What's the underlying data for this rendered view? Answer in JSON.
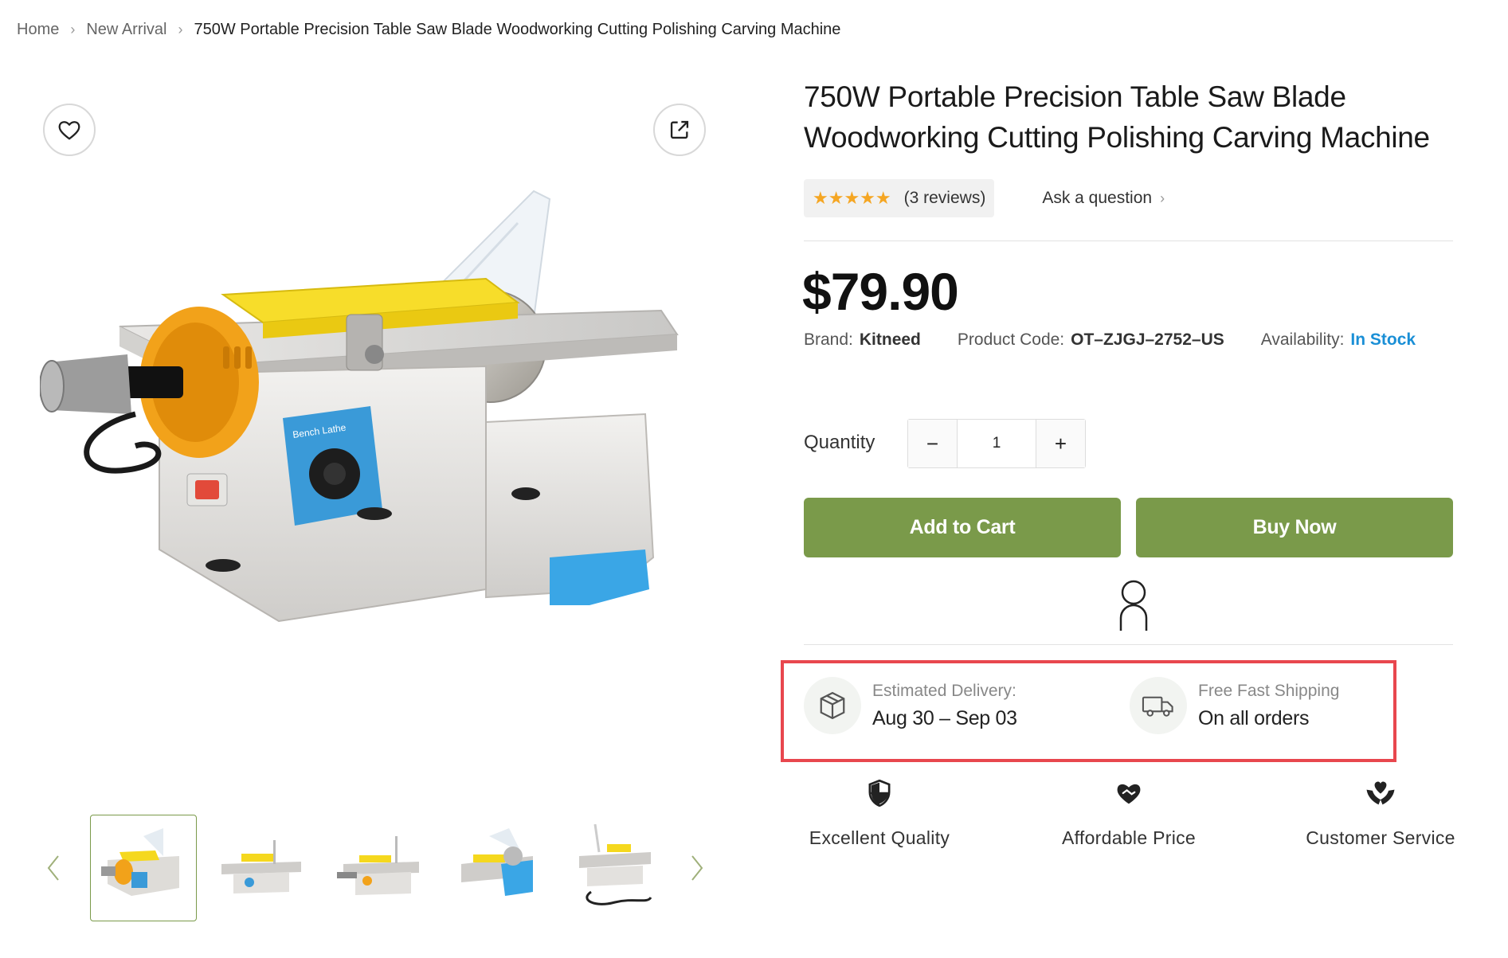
{
  "breadcrumb": {
    "items": [
      "Home",
      "New Arrival"
    ],
    "current": "750W Portable Precision Table Saw Blade Woodworking Cutting Polishing Carving Machine",
    "separator": "›"
  },
  "gallery": {
    "wishlist_icon": "heart-icon",
    "share_icon": "external-share-icon",
    "thumbnail_count": 5,
    "active_thumbnail": 1
  },
  "product": {
    "title": "750W Portable Precision Table Saw Blade Woodworking Cutting Polishing Carving Machine",
    "stars": "★★★★★",
    "rating": 5,
    "reviews": "(3 reviews)",
    "ask_question": "Ask a question",
    "price": "$79.90",
    "brand_label": "Brand:",
    "brand": "Kitneed",
    "code_label": "Product Code:",
    "code": "OT–ZJGJ–2752–US",
    "availability_label": "Availability:",
    "availability": "In Stock"
  },
  "quantity": {
    "label": "Quantity",
    "minus": "−",
    "value": "1",
    "plus": "+"
  },
  "actions": {
    "add_to_cart": "Add to Cart",
    "buy_now": "Buy Now"
  },
  "delivery": {
    "estimated_label": "Estimated Delivery:",
    "estimated_value": "Aug 30 – Sep 03",
    "shipping_label": "Free Fast Shipping",
    "shipping_value": "On all orders"
  },
  "features": [
    {
      "label": "Excellent Quality",
      "icon": "shield-icon"
    },
    {
      "label": "Affordable Price",
      "icon": "handshake-heart-icon"
    },
    {
      "label": "Customer Service",
      "icon": "hands-heart-icon"
    }
  ],
  "colors": {
    "accent_green": "#7a9a4a",
    "stock_blue": "#1a8fd6",
    "star_orange": "#f5a623",
    "highlight_red": "#e8474e"
  }
}
